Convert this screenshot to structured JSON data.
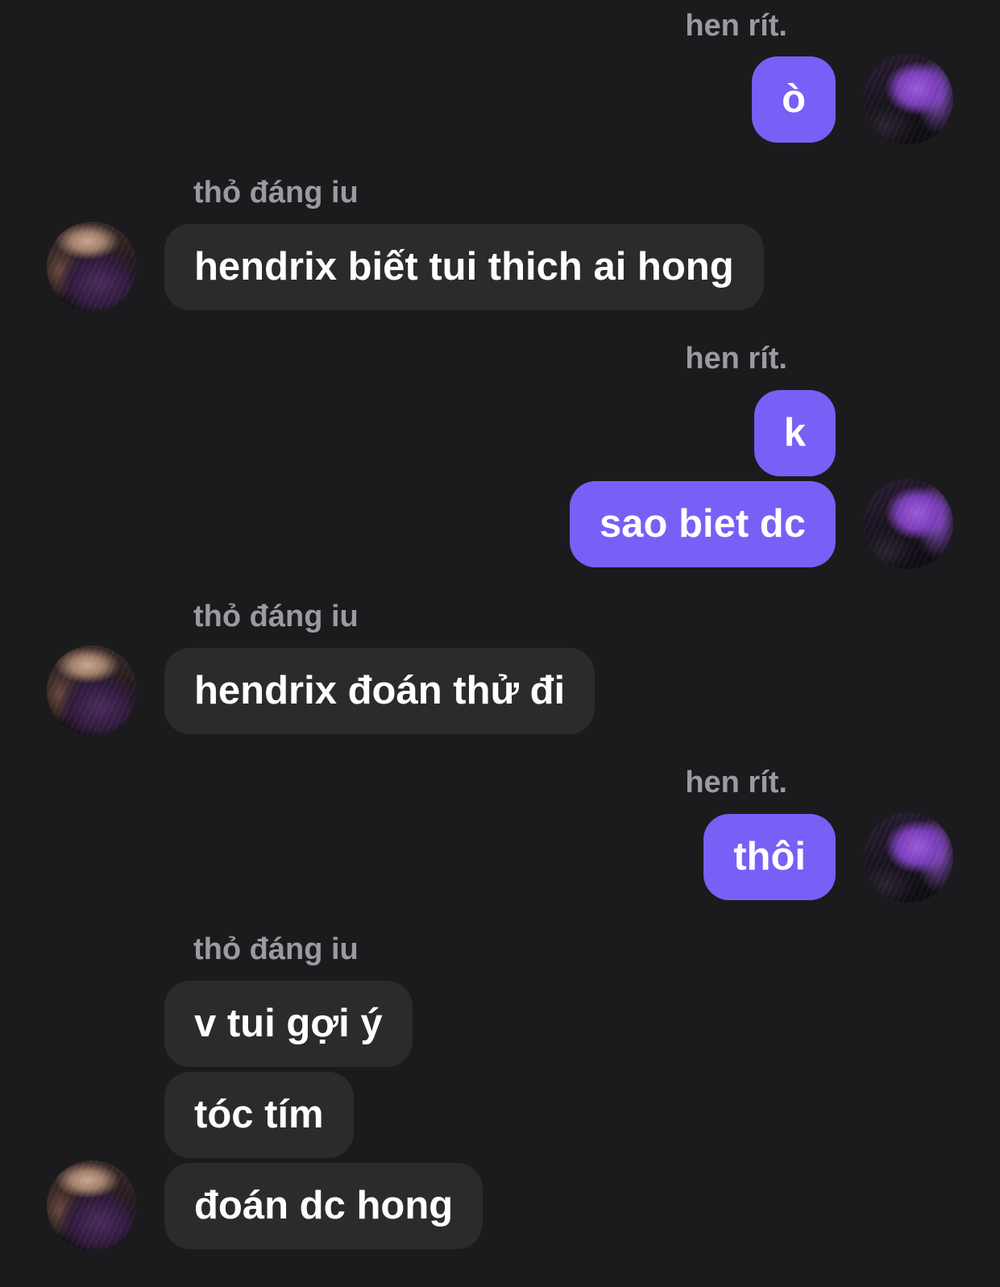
{
  "chat": {
    "me_name": "hen rít.",
    "her_name": "thỏ đáng iu",
    "messages": [
      {
        "sender": "hen rít.",
        "text": "ò"
      },
      {
        "sender": "thỏ đáng iu",
        "text": "hendrix biết tui thich ai hong"
      },
      {
        "sender": "hen rít.",
        "text": "k"
      },
      {
        "sender": "hen rít.",
        "text": "sao biet dc"
      },
      {
        "sender": "thỏ đáng iu",
        "text": "hendrix đoán thử đi"
      },
      {
        "sender": "hen rít.",
        "text": "thôi"
      },
      {
        "sender": "thỏ đáng iu",
        "text": "v tui gợi ý"
      },
      {
        "sender": "thỏ đáng iu",
        "text": "tóc tím"
      },
      {
        "sender": "thỏ đáng iu",
        "text": "đoán dc hong"
      }
    ]
  },
  "colors": {
    "background": "#1b1b1d",
    "outgoing_bubble": "#7760f5",
    "incoming_bubble": "#2b2b2e",
    "sender_name": "#9b9b9f",
    "message_text": "#ffffff"
  },
  "avatars": {
    "me": "user-avatar-purple-hair",
    "her": "user-avatar-face-partially-covered"
  }
}
